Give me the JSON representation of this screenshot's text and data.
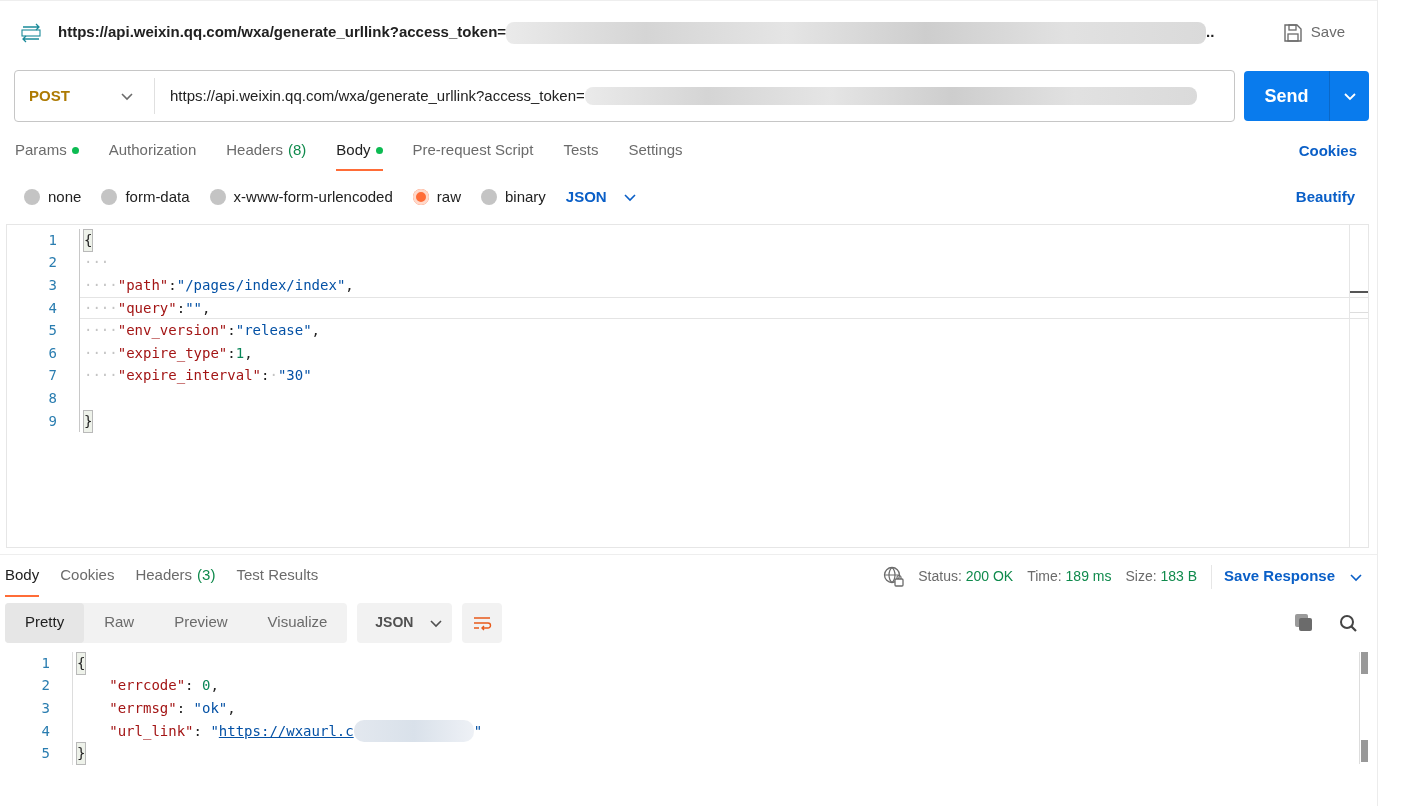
{
  "request": {
    "title_url": "https://api.weixin.qq.com/wxa/generate_urllink?access_token=",
    "title_redacted": true,
    "title_suffix": "..",
    "save": "Save",
    "method": "POST",
    "url": "https://api.weixin.qq.com/wxa/generate_urllink?access_token=",
    "url_redacted": true,
    "send": "Send"
  },
  "request_tabs": [
    {
      "label": "Params",
      "dot": true,
      "selected": false
    },
    {
      "label": "Authorization",
      "dot": false,
      "selected": false
    },
    {
      "label": "Headers",
      "count": "(8)",
      "dot": false,
      "selected": false
    },
    {
      "label": "Body",
      "dot": true,
      "selected": true
    },
    {
      "label": "Pre-request Script",
      "dot": false,
      "selected": false
    },
    {
      "label": "Tests",
      "dot": false,
      "selected": false
    },
    {
      "label": "Settings",
      "dot": false,
      "selected": false
    }
  ],
  "cookies_link": "Cookies",
  "body_types": [
    {
      "label": "none",
      "selected": false
    },
    {
      "label": "form-data",
      "selected": false
    },
    {
      "label": "x-www-form-urlencoded",
      "selected": false
    },
    {
      "label": "raw",
      "selected": true
    },
    {
      "label": "binary",
      "selected": false
    }
  ],
  "body_format": "JSON",
  "beautify": "Beautify",
  "request_body": {
    "lines": [
      {
        "number": "1",
        "current": false,
        "tokens": [
          {
            "kind": "brace",
            "text": "{"
          }
        ]
      },
      {
        "number": "2",
        "current": false,
        "tokens": [
          {
            "kind": "indent",
            "text": "···"
          }
        ]
      },
      {
        "number": "3",
        "current": false,
        "tokens": [
          {
            "kind": "indent",
            "text": "····"
          },
          {
            "kind": "key",
            "text": "\"path\""
          },
          {
            "kind": "punct",
            "text": ":"
          },
          {
            "kind": "string",
            "text": "\"/pages/index/index\""
          },
          {
            "kind": "punct",
            "text": ","
          }
        ]
      },
      {
        "number": "4",
        "current": true,
        "tokens": [
          {
            "kind": "indent",
            "text": "····"
          },
          {
            "kind": "key",
            "text": "\"query\""
          },
          {
            "kind": "punct",
            "text": ":"
          },
          {
            "kind": "string",
            "text": "\"\""
          },
          {
            "kind": "punct",
            "text": ","
          }
        ]
      },
      {
        "number": "5",
        "current": false,
        "tokens": [
          {
            "kind": "indent",
            "text": "····"
          },
          {
            "kind": "key",
            "text": "\"env_version\""
          },
          {
            "kind": "punct",
            "text": ":"
          },
          {
            "kind": "string",
            "text": "\"release\""
          },
          {
            "kind": "punct",
            "text": ","
          }
        ]
      },
      {
        "number": "6",
        "current": false,
        "tokens": [
          {
            "kind": "indent",
            "text": "····"
          },
          {
            "kind": "key",
            "text": "\"expire_type\""
          },
          {
            "kind": "punct",
            "text": ":"
          },
          {
            "kind": "number",
            "text": "1"
          },
          {
            "kind": "punct",
            "text": ","
          }
        ]
      },
      {
        "number": "7",
        "current": false,
        "tokens": [
          {
            "kind": "indent",
            "text": "····"
          },
          {
            "kind": "key",
            "text": "\"expire_interval\""
          },
          {
            "kind": "punct",
            "text": ":"
          },
          {
            "kind": "indent",
            "text": "·"
          },
          {
            "kind": "string",
            "text": "\"30\""
          }
        ]
      },
      {
        "number": "8",
        "current": false
      },
      {
        "number": "9",
        "current": false,
        "tokens": [
          {
            "kind": "brace",
            "text": "}"
          }
        ]
      }
    ]
  },
  "response_tabs": [
    {
      "label": "Body",
      "selected": true
    },
    {
      "label": "Cookies",
      "selected": false
    },
    {
      "label": "Headers",
      "count": "(3)",
      "selected": false
    },
    {
      "label": "Test Results",
      "selected": false
    }
  ],
  "response_stats": [
    {
      "label": "Status:",
      "value": "200 OK"
    },
    {
      "label": "Time:",
      "value": "189 ms"
    },
    {
      "label": "Size:",
      "value": "183 B"
    }
  ],
  "save_response": "Save Response",
  "view_modes": [
    {
      "label": "Pretty",
      "selected": true
    },
    {
      "label": "Raw",
      "selected": false
    },
    {
      "label": "Preview",
      "selected": false
    },
    {
      "label": "Visualize",
      "selected": false
    }
  ],
  "response_format": "JSON",
  "response_body": {
    "lines": [
      {
        "number": "1",
        "tokens": [
          {
            "kind": "brace",
            "text": "{"
          }
        ]
      },
      {
        "number": "2",
        "tokens": [
          {
            "kind": "key",
            "text": "\"errcode\""
          },
          {
            "kind": "punct",
            "text": ": "
          },
          {
            "kind": "number",
            "text": "0"
          },
          {
            "kind": "punct",
            "text": ","
          }
        ]
      },
      {
        "number": "3",
        "tokens": [
          {
            "kind": "key",
            "text": "\"errmsg\""
          },
          {
            "kind": "punct",
            "text": ": "
          },
          {
            "kind": "string",
            "text": "\"ok\""
          },
          {
            "kind": "punct",
            "text": ","
          }
        ]
      },
      {
        "number": "4",
        "tokens": [
          {
            "kind": "key",
            "text": "\"url_link\""
          },
          {
            "kind": "punct",
            "text": ": "
          },
          {
            "kind": "string",
            "text": "\""
          },
          {
            "kind": "link",
            "text": "https://wxaurl.c"
          },
          {
            "kind": "redacted"
          },
          {
            "kind": "string",
            "text": "\""
          }
        ]
      },
      {
        "number": "5",
        "tokens": [
          {
            "kind": "brace",
            "text": "}"
          }
        ]
      }
    ]
  }
}
